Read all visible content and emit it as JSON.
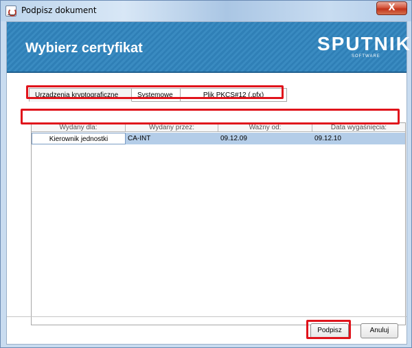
{
  "window": {
    "title": "Podpisz dokument",
    "close_label": "X"
  },
  "banner": {
    "title": "Wybierz certyfikat",
    "logo": "SPUTNIK",
    "logo_sub": "SOFTWARE"
  },
  "tabs": [
    {
      "label": "Urządzenia kryptograficzne",
      "active": true
    },
    {
      "label": "Systemowe",
      "active": false
    },
    {
      "label": "Plik PKCS#12 (.pfx)",
      "active": false
    }
  ],
  "table": {
    "columns": [
      "Wydany dla:",
      "Wydany przez:",
      "Ważny od:",
      "Data wygaśnięcia:"
    ],
    "rows": [
      [
        "Kierownik jednostki",
        "CA-INT",
        "09.12.09",
        "09.12.10"
      ]
    ]
  },
  "buttons": {
    "sign": "Podpisz",
    "cancel": "Anuluj"
  },
  "colors": {
    "highlight": "#e0131b",
    "banner": "#2f7fb6",
    "selection": "#b4cde8"
  }
}
